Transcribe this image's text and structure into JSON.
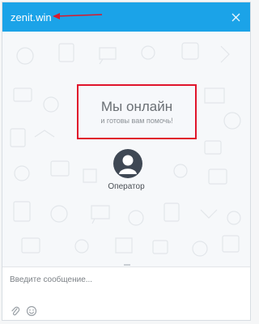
{
  "header": {
    "title": "zenit.win"
  },
  "status": {
    "title": "Мы онлайн",
    "subtitle": "и готовы вам помочь!"
  },
  "operator": {
    "name": "Оператор"
  },
  "composer": {
    "placeholder": "Введите сообщение..."
  },
  "colors": {
    "header": "#1ba3e8",
    "highlight": "#e0142b",
    "avatar": "#3f4854"
  },
  "icons": {
    "close": "close-icon",
    "attach": "paperclip-icon",
    "emoji": "smiley-icon",
    "avatar": "user-icon"
  }
}
